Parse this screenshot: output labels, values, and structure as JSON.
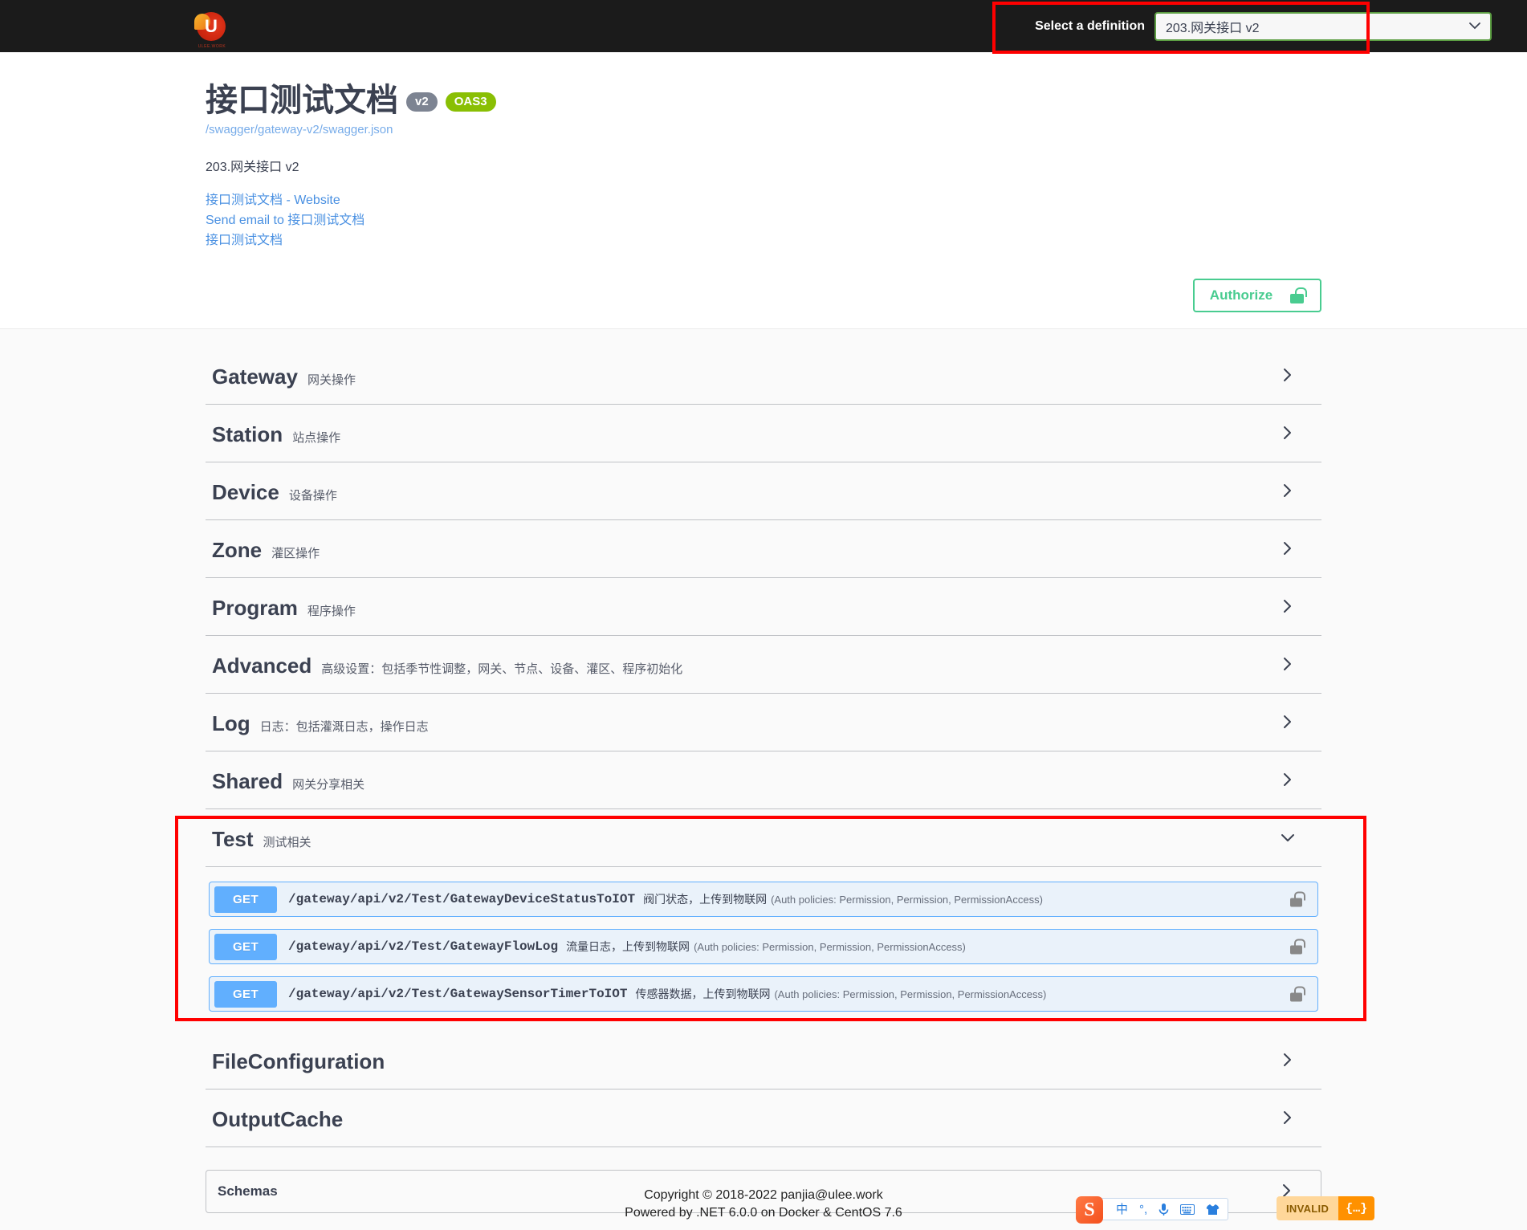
{
  "header": {
    "logo_name": "ulee-logo",
    "logo_letter": "U",
    "logo_subtext": "ULEE.WORK",
    "select_definition_label": "Select a definition",
    "selected_definition": "203.网关接口 v2",
    "chevron": "⌄"
  },
  "info": {
    "title": "接口测试文档",
    "badge_version": "v2",
    "badge_spec": "OAS3",
    "spec_url": "/swagger/gateway-v2/swagger.json",
    "description": "203.网关接口 v2",
    "links": [
      "接口测试文档 - Website",
      "Send email to 接口测试文档",
      "接口测试文档"
    ],
    "authorize_label": "Authorize"
  },
  "tags": [
    {
      "name": "Gateway",
      "desc": "网关操作",
      "open": false
    },
    {
      "name": "Station",
      "desc": "站点操作",
      "open": false
    },
    {
      "name": "Device",
      "desc": "设备操作",
      "open": false
    },
    {
      "name": "Zone",
      "desc": "灌区操作",
      "open": false
    },
    {
      "name": "Program",
      "desc": "程序操作",
      "open": false
    },
    {
      "name": "Advanced",
      "desc": "高级设置：包括季节性调整，网关、节点、设备、灌区、程序初始化",
      "open": false
    },
    {
      "name": "Log",
      "desc": "日志：包括灌溉日志，操作日志",
      "open": false
    },
    {
      "name": "Shared",
      "desc": "网关分享相关",
      "open": false
    },
    {
      "name": "Test",
      "desc": "测试相关",
      "open": true
    },
    {
      "name": "FileConfiguration",
      "desc": "",
      "open": false
    },
    {
      "name": "OutputCache",
      "desc": "",
      "open": false
    }
  ],
  "test_operations": [
    {
      "verb": "GET",
      "path": "/gateway/api/v2/Test/GatewayDeviceStatusToIOT",
      "summary": "阀门状态，上传到物联网",
      "auth": "(Auth policies: Permission, Permission, PermissionAccess)"
    },
    {
      "verb": "GET",
      "path": "/gateway/api/v2/Test/GatewayFlowLog",
      "summary": "流量日志，上传到物联网",
      "auth": "(Auth policies: Permission, Permission, PermissionAccess)"
    },
    {
      "verb": "GET",
      "path": "/gateway/api/v2/Test/GatewaySensorTimerToIOT",
      "summary": "传感器数据，上传到物联网",
      "auth": "(Auth policies: Permission, Permission, PermissionAccess)"
    }
  ],
  "schemas": {
    "label": "Schemas"
  },
  "footer": {
    "copyright": "Copyright © 2018-2022 panjia@ulee.work",
    "powered_by": "Powered by .NET 6.0.0 on Docker & CentOS 7.6"
  },
  "ime": {
    "logo": "S",
    "items": [
      "中",
      "°,",
      "mic",
      "keyboard",
      "skin"
    ]
  },
  "validator_badge": {
    "text": "INVALID",
    "icon": "{…}"
  },
  "colors": {
    "topbar_bg": "#1b1b1b",
    "select_border": "#5c9e43",
    "authorize_green": "#49cc90",
    "get_blue": "#61affe",
    "oas_green": "#89bf04",
    "v2_gray": "#7d8492",
    "annotation_red": "#ff0000",
    "link_blue": "#4990e2",
    "invalid_orange": "#ff9100"
  }
}
